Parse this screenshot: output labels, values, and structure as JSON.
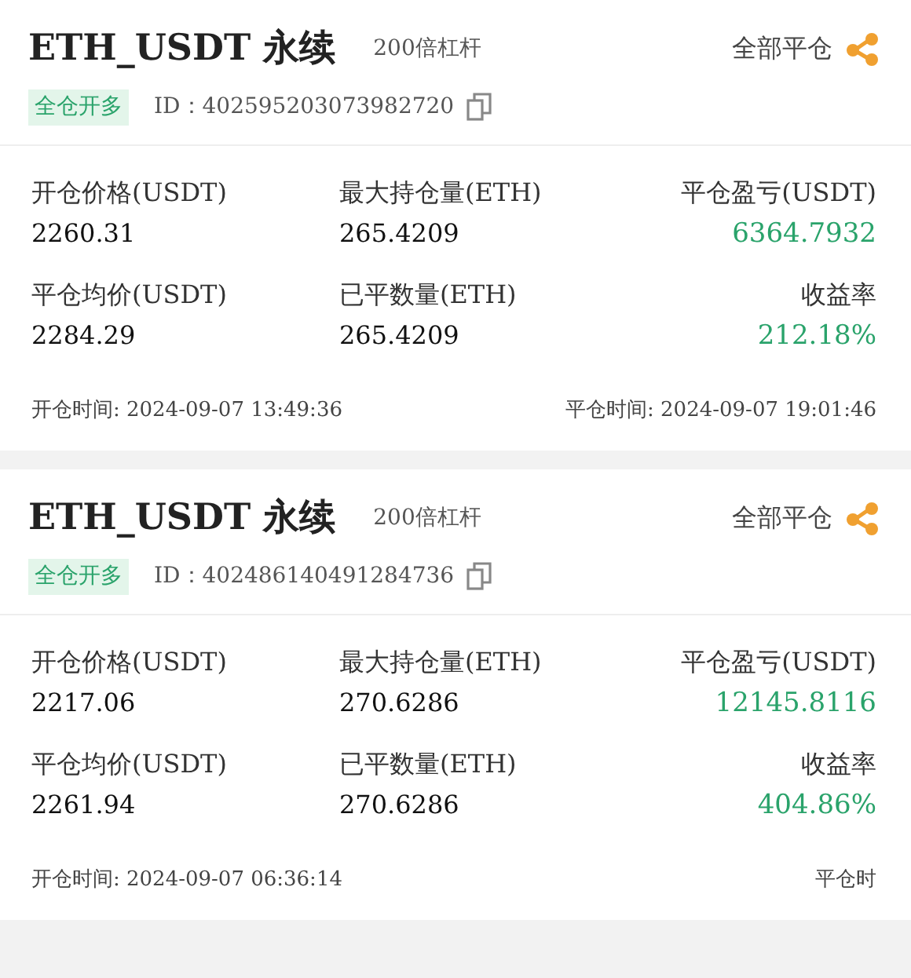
{
  "positions": [
    {
      "symbol": "ETH_USDT 永续",
      "leverage": "200倍杠杆",
      "close_all": "全部平仓",
      "tag": "全仓开多",
      "id": "ID：402595203073982720",
      "stats": [
        {
          "label": "开仓价格(USDT)",
          "value": "2260.31",
          "kind": "plain"
        },
        {
          "label": "最大持仓量(ETH)",
          "value": "265.4209",
          "kind": "plain"
        },
        {
          "label": "平仓盈亏(USDT)",
          "value": "6364.7932",
          "kind": "profit"
        },
        {
          "label": "平仓均价(USDT)",
          "value": "2284.29",
          "kind": "plain"
        },
        {
          "label": "已平数量(ETH)",
          "value": "265.4209",
          "kind": "plain"
        },
        {
          "label": "收益率",
          "value": "212.18%",
          "kind": "profit"
        }
      ],
      "open_time": "开仓时间: 2024-09-07 13:49:36",
      "close_time": "平仓时间: 2024-09-07 19:01:46"
    },
    {
      "symbol": "ETH_USDT 永续",
      "leverage": "200倍杠杆",
      "close_all": "全部平仓",
      "tag": "全仓开多",
      "id": "ID：402486140491284736",
      "stats": [
        {
          "label": "开仓价格(USDT)",
          "value": "2217.06",
          "kind": "plain"
        },
        {
          "label": "最大持仓量(ETH)",
          "value": "270.6286",
          "kind": "plain"
        },
        {
          "label": "平仓盈亏(USDT)",
          "value": "12145.8116",
          "kind": "profit"
        },
        {
          "label": "平仓均价(USDT)",
          "value": "2261.94",
          "kind": "plain"
        },
        {
          "label": "已平数量(ETH)",
          "value": "270.6286",
          "kind": "plain"
        },
        {
          "label": "收益率",
          "value": "404.86%",
          "kind": "profit"
        }
      ],
      "open_time": "开仓时间: 2024-09-07 06:36:14",
      "close_time": "平仓时"
    }
  ]
}
